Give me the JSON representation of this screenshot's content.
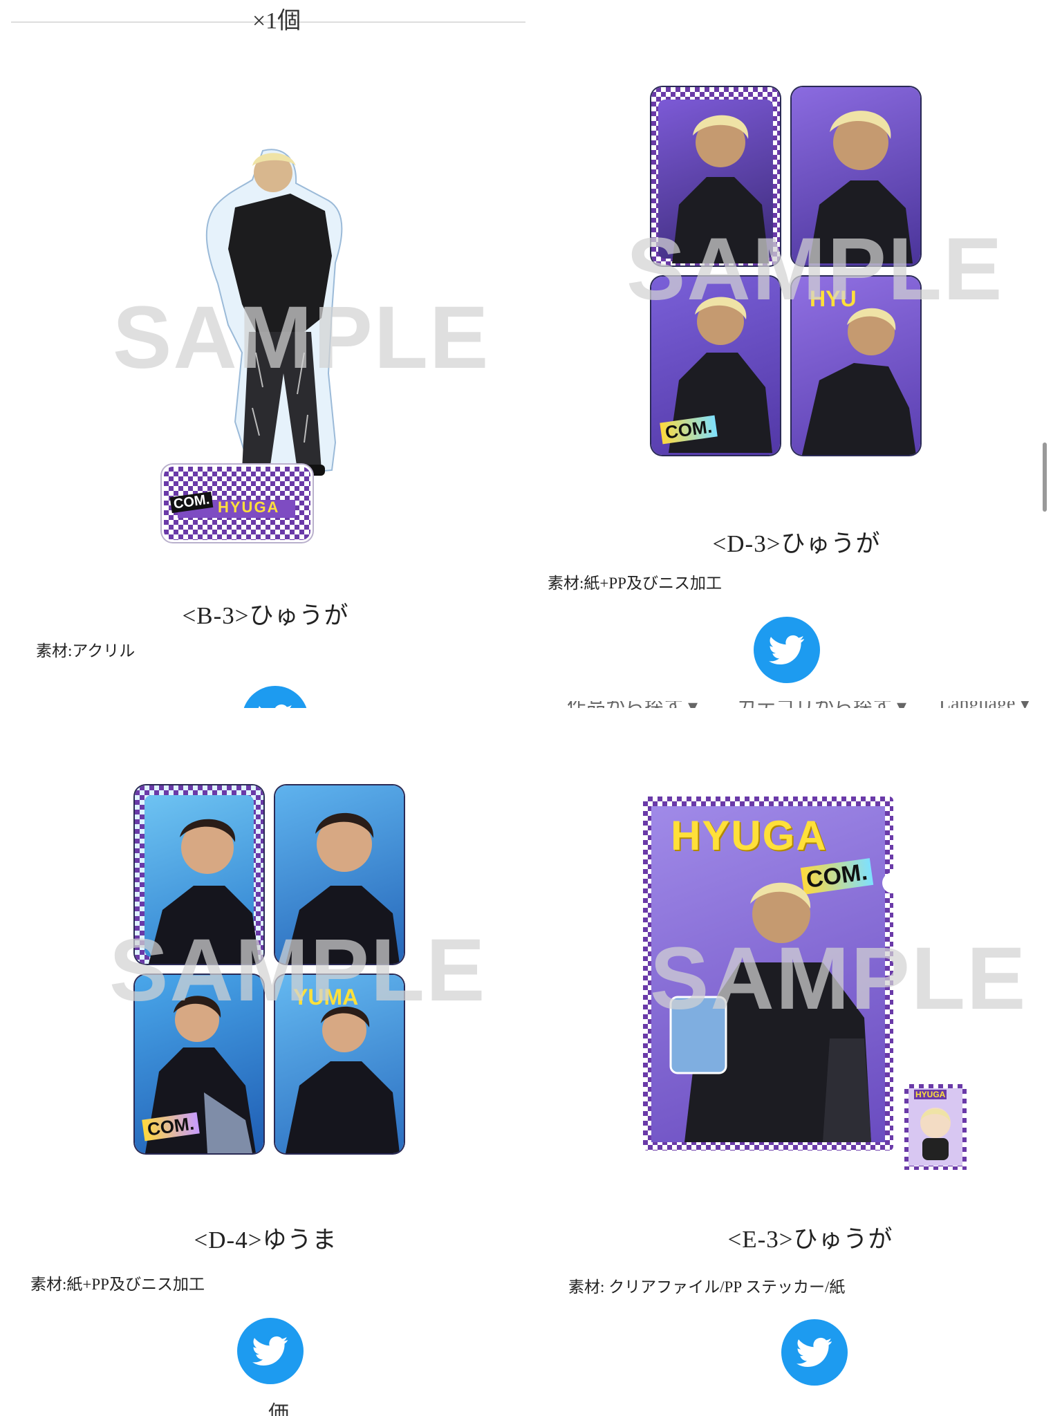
{
  "panels": [
    {
      "cut_top_text": "×1個",
      "title": "<B-3>ひゅうが",
      "material": "素材:アクリル",
      "watermark": "SAMPLE",
      "stand_label": "HYUGA",
      "stand_logo": "COM."
    },
    {
      "title": "<D-3>ひゅうが",
      "material": "素材:紙+PP及びニス加工",
      "watermark": "SAMPLE",
      "card_label": "HYU",
      "card_logo": "COM.",
      "nav": [
        "作品から探す ▾",
        "カテゴリから探す ▾",
        "Language ▾"
      ]
    },
    {
      "title": "<D-4>ゆうま",
      "material": "素材:紙+PP及びニス加工",
      "watermark": "SAMPLE",
      "card_label": "YUMA",
      "card_logo": "COM.",
      "cut_bottom_text": "価"
    },
    {
      "title": "<E-3>ひゅうが",
      "material": "素材: クリアファイル/PP ステッカー/紙",
      "watermark": "SAMPLE",
      "file_label": "HYUGA",
      "file_logo": "COM.",
      "sticker_label": "HYUGA"
    }
  ],
  "colors": {
    "twitter_blue": "#1d9bf0",
    "purple_accent": "#6a3aa8",
    "card_blue": "#3a8fd8"
  },
  "icons": {
    "share": "twitter-bird-icon"
  }
}
